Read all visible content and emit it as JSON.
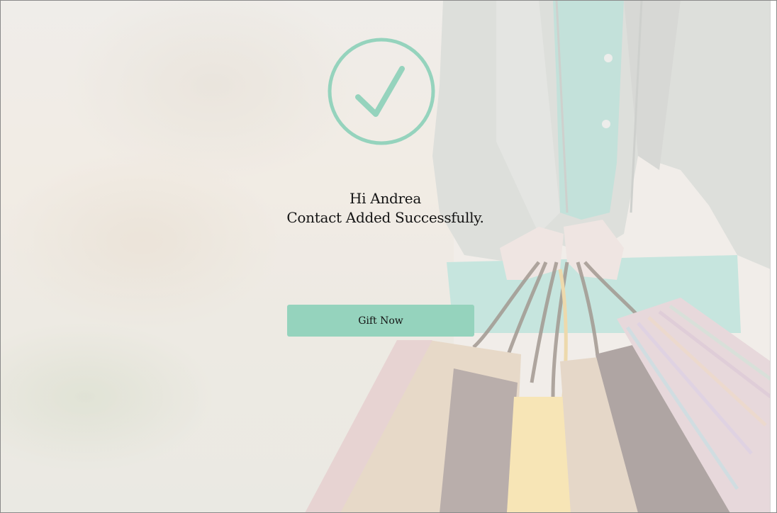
{
  "background": {
    "description_icon": "shopping-bags-photo"
  },
  "success": {
    "icon": "checkmark-circle-icon",
    "color": "#95d3bd",
    "greeting": "Hi Andrea",
    "message": "Contact Added Successfully."
  },
  "actions": {
    "gift_label": "Gift Now"
  }
}
